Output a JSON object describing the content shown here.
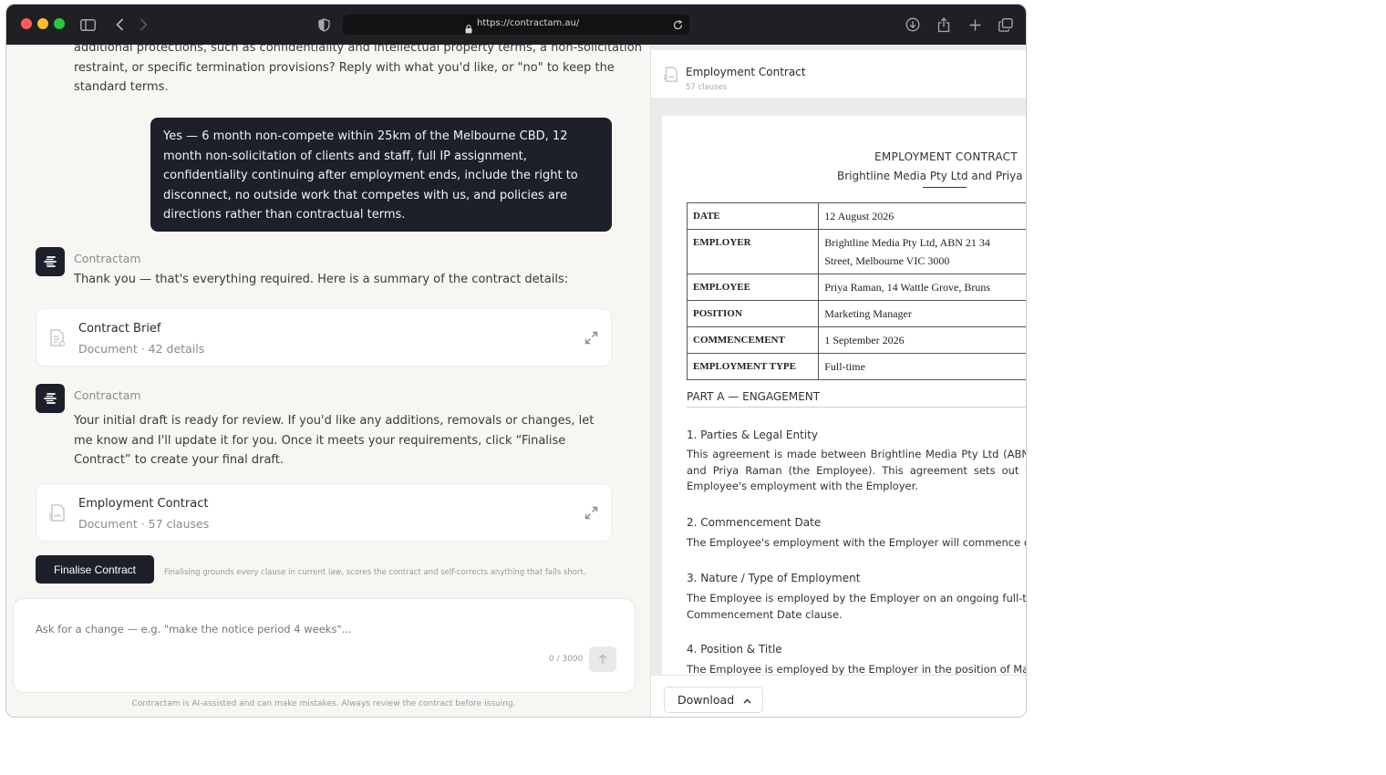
{
  "browser": {
    "url": "https://contractam.au/"
  },
  "chat": {
    "prev_message_lines": [
      "additional protections, such as confidentiality and intellectual property terms, a non-solicitation",
      "restraint, or specific termination provisions? Reply with what you'd like, or \"no\" to keep the",
      "standard terms."
    ],
    "user_message": "Yes — 6 month non-compete within 25km of the Melbourne CBD, 12 month non-solicitation of clients and staff, full IP assignment, confidentiality continuing after employment ends, include the right to disconnect, no outside work that competes with us, and policies are directions rather than contractual terms.",
    "assistant_name": "Contractam",
    "reply_1": "Thank you — that's everything required. Here is a summary of the contract details:",
    "brief_card": {
      "title": "Contract Brief",
      "subtitle": "Document · 42 details"
    },
    "reply_2": "Your initial draft is ready for review. If you'd like any additions, removals or changes, let me know and I'll update it for you. Once it meets your requirements, click “Finalise Contract” to create your final draft.",
    "contract_card": {
      "title": "Employment Contract",
      "subtitle": "Document · 57 clauses"
    },
    "finalise_label": "Finalise Contract",
    "finalise_note": "Finalising grounds every clause in current law, scores the contract and self-corrects anything that falls short.",
    "composer_placeholder": "Ask for a change — e.g. \"make the notice period 4 weeks\"...",
    "counter": "0 / 3000",
    "disclaimer": "Contractam is AI-assisted and can make mistakes. Always review the contract before issuing."
  },
  "document": {
    "header_title": "Employment Contract",
    "header_sub": "57 clauses",
    "title": "EMPLOYMENT CONTRACT",
    "parties": "Brightline Media Pty Ltd and Priya Ra",
    "details": [
      {
        "key": "DATE",
        "value": "12 August 2026"
      },
      {
        "key": "EMPLOYER",
        "value": "Brightline Media Pty Ltd, ABN 21 34",
        "value2": "Street, Melbourne VIC 3000"
      },
      {
        "key": "EMPLOYEE",
        "value": "Priya Raman, 14 Wattle Grove, Bruns"
      },
      {
        "key": "POSITION",
        "value": "Marketing Manager"
      },
      {
        "key": "COMMENCEMENT",
        "value": "1 September 2026"
      },
      {
        "key": "EMPLOYMENT TYPE",
        "value": "Full-time"
      }
    ],
    "part_a": "PART A — ENGAGEMENT",
    "s1_h": "1. Parties & Legal Entity",
    "s1_p": "This agreement is made between Brightline Media Pty Ltd (ABN and Priya Raman (the Employee). This agreement sets out t Employee's employment with the Employer.",
    "s2_h": "2. Commencement Date",
    "s2_p": "The Employee's employment with the Employer will commence on",
    "s3_h": "3. Nature / Type of Employment",
    "s3_p": "The Employee is employed by the Employer on an ongoing full-ti Commencement Date clause.",
    "s4_h": "4. Position & Title",
    "s4_p": "The Employee is employed by the Employer in the position of Mark",
    "download_label": "Download"
  }
}
